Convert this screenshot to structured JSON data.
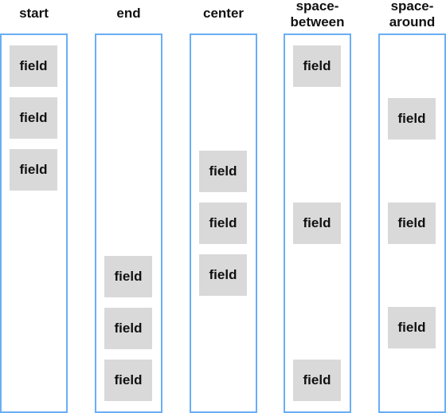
{
  "colors": {
    "border": "#6aaef5",
    "field_bg": "#d9d9d9"
  },
  "columns": [
    {
      "title": "start",
      "fields": [
        "field",
        "field",
        "field"
      ]
    },
    {
      "title": "end",
      "fields": [
        "field",
        "field",
        "field"
      ]
    },
    {
      "title": "center",
      "fields": [
        "field",
        "field",
        "field"
      ]
    },
    {
      "title": "space-between",
      "fields": [
        "field",
        "field",
        "field"
      ]
    },
    {
      "title": "space-around",
      "fields": [
        "field",
        "field",
        "field"
      ]
    }
  ]
}
